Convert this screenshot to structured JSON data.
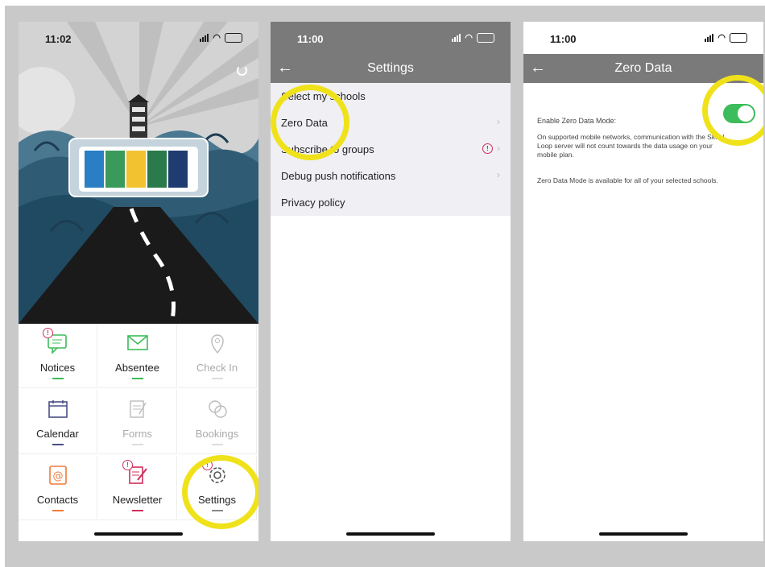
{
  "phone1": {
    "time": "11:02",
    "battery": "",
    "tiles": [
      {
        "label": "Notices",
        "icon": "notices-icon",
        "bar": "#3cbc5a",
        "dim": false,
        "badge": "!"
      },
      {
        "label": "Absentee",
        "icon": "envelope-icon",
        "bar": "#3cbc5a",
        "dim": false,
        "badge": ""
      },
      {
        "label": "Check In",
        "icon": "location-pin-icon",
        "bar": "#dddddd",
        "dim": true,
        "badge": ""
      },
      {
        "label": "Calendar",
        "icon": "calendar-icon",
        "bar": "#4a4f86",
        "dim": false,
        "badge": ""
      },
      {
        "label": "Forms",
        "icon": "forms-icon",
        "bar": "#dddddd",
        "dim": true,
        "badge": ""
      },
      {
        "label": "Bookings",
        "icon": "bookings-icon",
        "bar": "#dddddd",
        "dim": true,
        "badge": ""
      },
      {
        "label": "Contacts",
        "icon": "contacts-icon",
        "bar": "#f07a3a",
        "dim": false,
        "badge": ""
      },
      {
        "label": "Newsletter",
        "icon": "newsletter-icon",
        "bar": "#d0305a",
        "dim": false,
        "badge": "!"
      },
      {
        "label": "Settings",
        "icon": "gear-icon",
        "bar": "#888888",
        "dim": false,
        "badge": "!"
      }
    ]
  },
  "phone2": {
    "time": "11:00",
    "title": "Settings",
    "rows": [
      {
        "label": "Select my schools",
        "chevron": false,
        "alert": false
      },
      {
        "label": "Zero Data",
        "chevron": true,
        "alert": false
      },
      {
        "label": "Subscribe to groups",
        "chevron": true,
        "alert": true
      },
      {
        "label": "Debug push notifications",
        "chevron": true,
        "alert": false
      },
      {
        "label": "Privacy policy",
        "chevron": false,
        "alert": false
      }
    ]
  },
  "phone3": {
    "time": "11:00",
    "title": "Zero Data",
    "toggle_label": "Enable Zero Data Mode:",
    "toggle_on": true,
    "para1": "On supported mobile networks, communication with the Skool Loop server will not count towards the data usage on your mobile plan.",
    "para2": "Zero Data Mode is available for all of your selected schools."
  },
  "colors": {
    "highlight": "#f0e21a",
    "toggle_on": "#3cbc5a",
    "nav": "#7a7a7a",
    "alert": "#d0305a"
  }
}
